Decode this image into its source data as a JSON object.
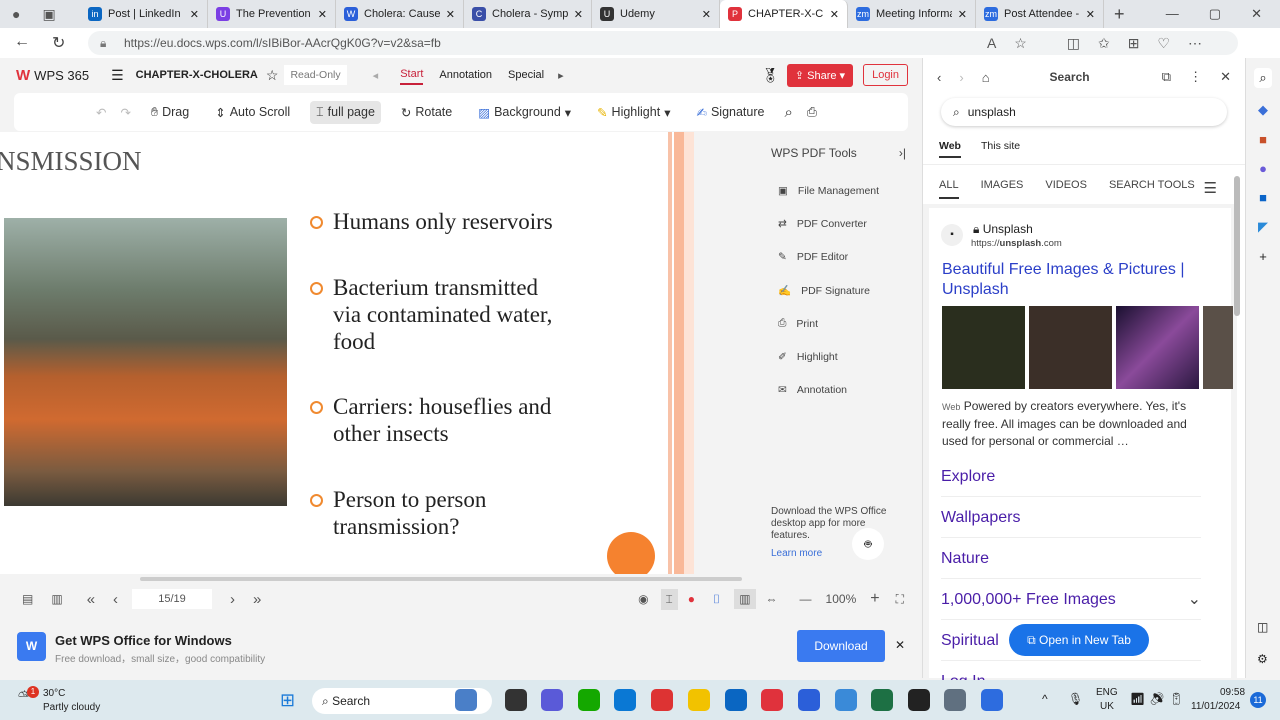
{
  "browser": {
    "tabs": [
      {
        "label": "Post | LinkedIn",
        "color": "#0a66c2",
        "glyph": "in"
      },
      {
        "label": "The Prevention A",
        "color": "#7b3fe4",
        "glyph": "U"
      },
      {
        "label": "Cholera: Causes,",
        "color": "#2b5fd9",
        "glyph": "W"
      },
      {
        "label": "Cholera - Sympt",
        "color": "#3a4fa8",
        "glyph": "C"
      },
      {
        "label": "Udemy",
        "color": "#333",
        "glyph": "U"
      },
      {
        "label": "CHAPTER-X-CHC",
        "color": "#e0323c",
        "glyph": "P",
        "active": true
      },
      {
        "label": "Meeting Informa",
        "color": "#2d6cdf",
        "glyph": "zm"
      },
      {
        "label": "Post Attendee -",
        "color": "#2d6cdf",
        "glyph": "zm"
      }
    ],
    "url": "https://eu.docs.wps.com/l/sIBiBor-AAcrQgK0G?v=v2&sa=fb"
  },
  "wps": {
    "logo": "WPS 365",
    "doc_title": "CHAPTER-X-CHOLERA",
    "read_only": "Read-Only",
    "menu": [
      "Start",
      "Annotation",
      "Special"
    ],
    "share": "Share",
    "login": "Login",
    "toolbar": [
      "Drag",
      "Auto Scroll",
      "full page",
      "Rotate",
      "Background",
      "Highlight",
      "Signature"
    ],
    "slide": {
      "heading": "NSMISSION",
      "bullets": [
        [
          "Humans only reservoirs"
        ],
        [
          "Bacterium transmitted",
          "via contaminated water,",
          "food"
        ],
        [
          "Carriers: houseflies and",
          "other insects"
        ],
        [
          "Person to person",
          "transmission?"
        ]
      ]
    },
    "tools": {
      "title": "WPS PDF Tools",
      "items": [
        "File Management",
        "PDF Converter",
        "PDF Editor",
        "PDF Signature",
        "Print",
        "Highlight",
        "Annotation"
      ],
      "promo": "Download the WPS Office desktop app for more features.",
      "learn_more": "Learn more"
    },
    "page": "15/19",
    "zoom": "100%",
    "banner": {
      "title": "Get WPS Office for Windows",
      "sub": "Free download，small size，good compatibility",
      "download": "Download"
    }
  },
  "sidebar": {
    "title": "Search",
    "query": "unsplash",
    "scopes": [
      "Web",
      "This site"
    ],
    "tabs": [
      "ALL",
      "IMAGES",
      "VIDEOS",
      "SEARCH TOOLS"
    ],
    "result": {
      "site": "Unsplash",
      "url_prefix": "https://",
      "url_bold": "unsplash",
      "url_suffix": ".com",
      "title": "Beautiful Free Images & Pictures | Unsplash",
      "web": "Web",
      "snippet": "Powered by creators everywhere. Yes, it's really free. All images can be downloaded and used for personal or commercial …"
    },
    "links": [
      "Explore",
      "Wallpapers",
      "Nature",
      "1,000,000+ Free Images",
      "Spiritual",
      "Log In"
    ],
    "open_new_tab": "Open in New Tab"
  },
  "taskbar": {
    "temp": "30°C",
    "weather": "Partly cloudy",
    "badge": "1",
    "search": "Search",
    "lang1": "ENG",
    "lang2": "UK",
    "time": "09:58",
    "date": "11/01/2024",
    "notif": "11"
  }
}
